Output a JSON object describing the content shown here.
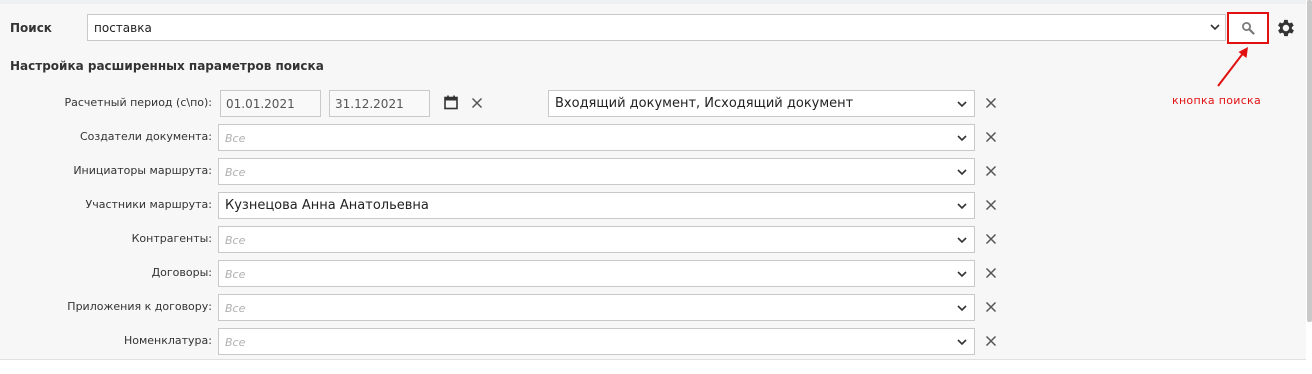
{
  "search": {
    "label": "Поиск",
    "value": "поставка"
  },
  "advanced": {
    "title": "Настройка расширенных параметров поиска",
    "period": {
      "label": "Расчетный период (с\\по):",
      "from": "01.01.2021",
      "to": "31.12.2021",
      "doc_types": "Входящий документ, Исходящий документ"
    },
    "rows": [
      {
        "label": "Создатели документа:",
        "value": "",
        "placeholder": "Все"
      },
      {
        "label": "Инициаторы маршрута:",
        "value": "",
        "placeholder": "Все"
      },
      {
        "label": "Участники маршрута:",
        "value": "Кузнецова Анна Анатольевна",
        "placeholder": ""
      },
      {
        "label": "Контрагенты:",
        "value": "",
        "placeholder": "Все"
      },
      {
        "label": "Договоры:",
        "value": "",
        "placeholder": "Все"
      },
      {
        "label": "Приложения к договору:",
        "value": "",
        "placeholder": "Все"
      },
      {
        "label": "Номенклатура:",
        "value": "",
        "placeholder": "Все"
      }
    ]
  },
  "annotation": {
    "text": "кнопка поиска"
  },
  "icons": {
    "search": "search-icon",
    "settings": "gear-icon",
    "calendar": "calendar-icon",
    "clear": "close-icon",
    "dropdown": "chevron-down-icon"
  },
  "colors": {
    "annotation": "#e21111"
  }
}
